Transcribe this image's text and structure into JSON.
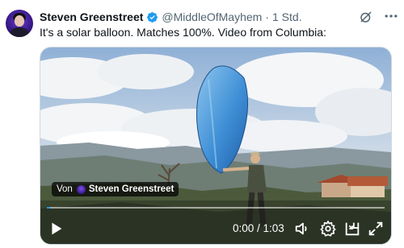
{
  "tweet": {
    "author_name": "Steven Greenstreet",
    "handle": "@MiddleOfMayhem",
    "separator": "·",
    "time": "1 Std.",
    "text": "It's a solar balloon. Matches 100%. Video from Columbia:"
  },
  "icons": {
    "verified": "verified-badge-icon",
    "grok": "grok-icon",
    "more": "more-options-icon",
    "play": "play-icon",
    "volume": "volume-icon",
    "settings": "settings-gear-icon",
    "dock": "dock-icon",
    "fullscreen": "fullscreen-icon"
  },
  "video": {
    "byline_prefix": "Von",
    "byline_name": "Steven Greenstreet",
    "time_display": "0:00 / 1:03",
    "progress_fraction": 0.01
  },
  "colors": {
    "accent": "#1d9bf0",
    "text_primary": "#0f1419",
    "text_secondary": "#536471"
  }
}
